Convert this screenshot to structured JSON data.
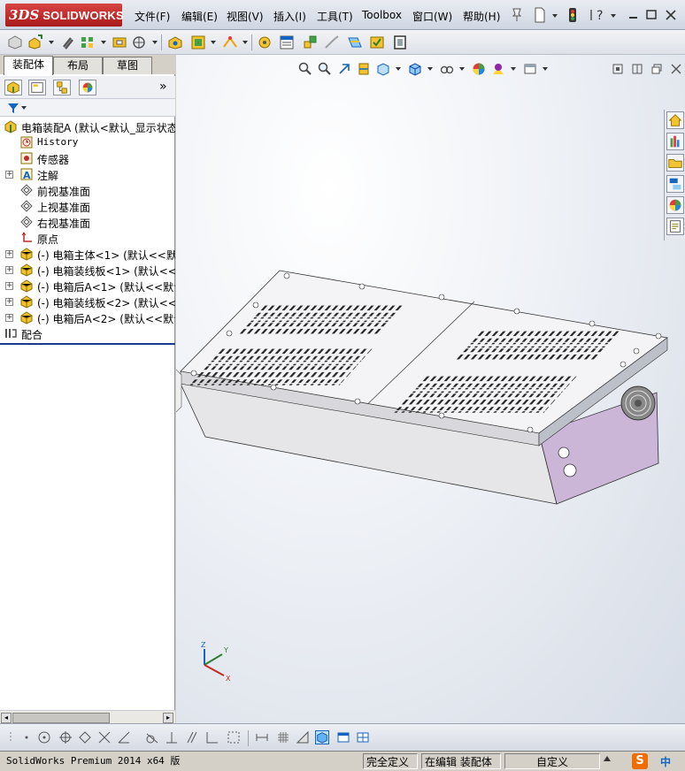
{
  "app": {
    "brand_prefix": "3DS",
    "brand": "SOLIDWORKS"
  },
  "menu": {
    "items": [
      "文件(F)",
      "编辑(E)",
      "视图(V)",
      "插入(I)",
      "工具(T)",
      "Toolbox",
      "窗口(W)",
      "帮助(H)"
    ]
  },
  "feature_manager": {
    "tabs": [
      "装配体",
      "布局",
      "草图"
    ],
    "active_tab": "装配体",
    "expand_more": "»",
    "tree": [
      {
        "label": "电箱装配A  (默认<默认_显示状态",
        "icon": "assembly-icon",
        "indent": 0,
        "expandable": false
      },
      {
        "label": "History",
        "icon": "history-icon",
        "indent": 1,
        "expandable": false,
        "mono": true
      },
      {
        "label": "传感器",
        "icon": "sensor-icon",
        "indent": 1,
        "expandable": false
      },
      {
        "label": "注解",
        "icon": "annotation-icon",
        "indent": 1,
        "expandable": true
      },
      {
        "label": "前视基准面",
        "icon": "plane-icon",
        "indent": 1,
        "expandable": false
      },
      {
        "label": "上视基准面",
        "icon": "plane-icon",
        "indent": 1,
        "expandable": false
      },
      {
        "label": "右视基准面",
        "icon": "plane-icon",
        "indent": 1,
        "expandable": false
      },
      {
        "label": "原点",
        "icon": "origin-icon",
        "indent": 1,
        "expandable": false
      },
      {
        "label": "(-) 电箱主体<1> (默认<<默认",
        "icon": "part-icon",
        "indent": 1,
        "expandable": true
      },
      {
        "label": "(-) 电箱装线板<1> (默认<<默",
        "icon": "part-icon",
        "indent": 1,
        "expandable": true
      },
      {
        "label": "(-) 电箱后A<1> (默认<<默认",
        "icon": "part-icon",
        "indent": 1,
        "expandable": true
      },
      {
        "label": "(-) 电箱装线板<2> (默认<<默",
        "icon": "part-icon",
        "indent": 1,
        "expandable": true
      },
      {
        "label": "(-) 电箱后A<2> (默认<<默认",
        "icon": "part-icon",
        "indent": 1,
        "expandable": true
      },
      {
        "label": "配合",
        "icon": "mates-icon",
        "indent": 0,
        "expandable": false
      }
    ]
  },
  "status": {
    "app_version": "SolidWorks Premium 2014 x64 版",
    "definition": "完全定义",
    "editing": "在编辑 装配体",
    "units": "自定义",
    "ime": "中"
  },
  "colors": {
    "accent": "#1e3a8a",
    "logo_red": "#c62828",
    "enclosure_side": "#c9b2d6",
    "enclosure_front": "#e4e4e4"
  }
}
